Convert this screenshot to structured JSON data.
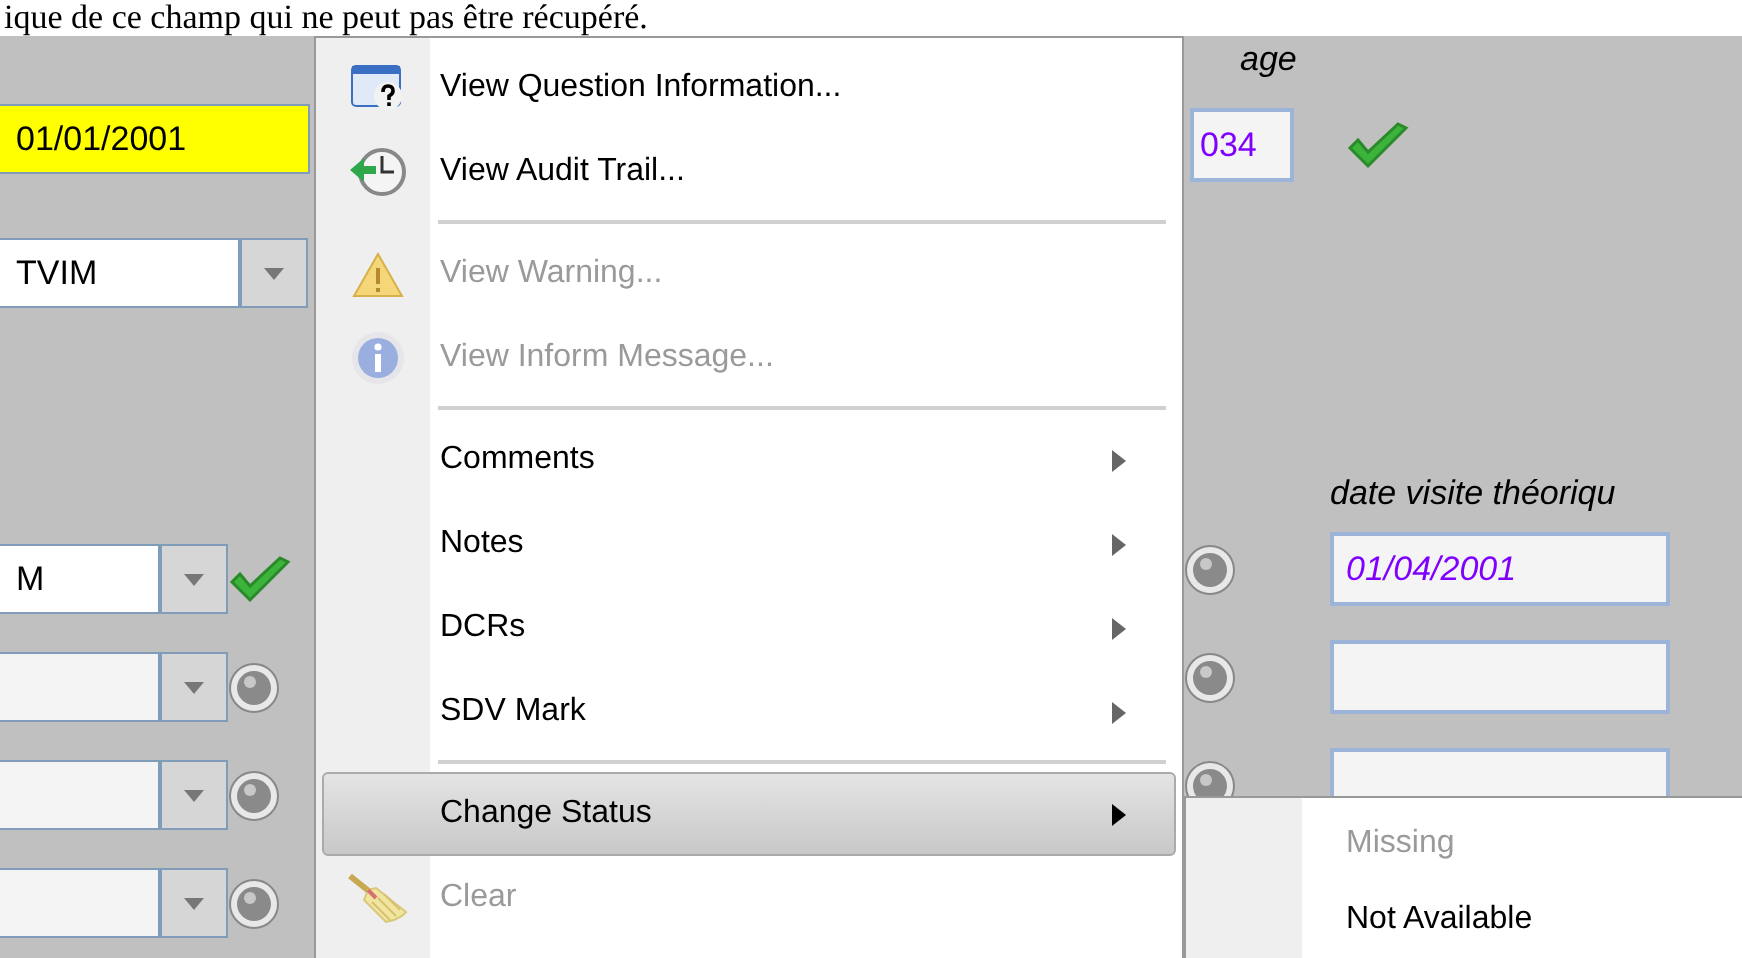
{
  "document_text": "ique de ce champ qui ne peut pas être récupéré.",
  "left_fields": [
    {
      "kind": "date",
      "value": "01/01/2001",
      "highlighted": true
    },
    {
      "kind": "combo",
      "value": "TVIM",
      "highlighted": false
    },
    {
      "kind": "combo",
      "value": "M",
      "highlighted": false,
      "validated": true
    },
    {
      "kind": "combo",
      "highlighted": false,
      "validated": false
    },
    {
      "kind": "combo",
      "highlighted": false,
      "validated": false
    },
    {
      "kind": "combo",
      "highlighted": false,
      "validated": false
    }
  ],
  "context_menu": [
    {
      "kind": "item",
      "label": "View Question Information...",
      "disabled": false,
      "submenu": false,
      "selected": false
    },
    {
      "kind": "item",
      "label": "View Audit Trail...",
      "disabled": false,
      "submenu": false,
      "selected": false
    },
    {
      "kind": "separator"
    },
    {
      "kind": "item",
      "label": "View Warning...",
      "disabled": true,
      "submenu": false,
      "selected": false
    },
    {
      "kind": "item",
      "label": "View Inform Message...",
      "disabled": true,
      "submenu": false,
      "selected": false
    },
    {
      "kind": "separator"
    },
    {
      "kind": "item",
      "label": "Comments",
      "disabled": false,
      "submenu": true,
      "selected": false
    },
    {
      "kind": "item",
      "label": "Notes",
      "disabled": false,
      "submenu": true,
      "selected": false
    },
    {
      "kind": "item",
      "label": "DCRs",
      "disabled": false,
      "submenu": true,
      "selected": false
    },
    {
      "kind": "item",
      "label": "SDV Mark",
      "disabled": false,
      "submenu": true,
      "selected": false
    },
    {
      "kind": "separator"
    },
    {
      "kind": "item",
      "label": "Change Status",
      "disabled": false,
      "submenu": true,
      "selected": true
    },
    {
      "kind": "item",
      "label": "Clear",
      "disabled": true,
      "submenu": false,
      "selected": false
    }
  ],
  "submenu": [
    {
      "label": "Missing",
      "disabled": true
    },
    {
      "label": "Not Available",
      "disabled": false
    }
  ],
  "age": {
    "label": "age",
    "value": "034",
    "validated": true
  },
  "visit_date": {
    "label": "date visite théoriqu",
    "rows": [
      {
        "value": "01/04/2001",
        "validated": false
      },
      {
        "validated": false
      },
      {
        "validated": false
      }
    ]
  }
}
